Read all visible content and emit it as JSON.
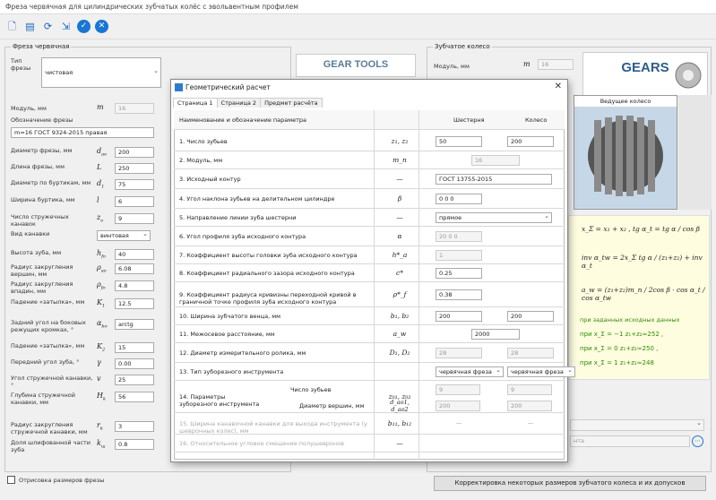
{
  "window": {
    "title": "Фреза червячная для цилиндрических зубчатых колёс с эвольвентным профилем"
  },
  "toolbar": {
    "icons": [
      "new-file-icon",
      "open-icon",
      "refresh-icon",
      "import-icon",
      "ok-icon",
      "cancel-icon"
    ]
  },
  "left": {
    "group_title": "Фреза червячная",
    "type_label": "Тип фрезы",
    "type_value": "чистовая",
    "module_label": "Модуль, мм",
    "module_sym": "m",
    "module_value": "16",
    "designation_label": "Обозначение фрезы",
    "designation_value": "m=16 ГОСТ 9324-2015 правая",
    "rows": [
      {
        "label": "Диаметр фрезы, мм",
        "sym": "d",
        "value": "200"
      },
      {
        "label": "Длина фрезы, мм",
        "sym": "L",
        "value": "250"
      },
      {
        "label": "Диаметр по буртикам, мм",
        "sym": "d",
        "value": "75"
      },
      {
        "label": "Ширина буртика, мм",
        "sym": "l",
        "value": "6"
      },
      {
        "label": "Число стружечных канавок",
        "sym": "z",
        "value": "9"
      },
      {
        "label": "Вид канавки",
        "sym": "",
        "value": "винтовая"
      },
      {
        "label": "Высота зуба, мм",
        "sym": "h",
        "value": "40"
      },
      {
        "label": "Радиус закругления вершин, мм",
        "sym": "ρ",
        "value": "6.08"
      },
      {
        "label": "Радиус закругления впадин, мм",
        "sym": "ρ",
        "value": "4.8"
      },
      {
        "label": "Падение «затылка», мм",
        "sym": "K",
        "value": "12.5"
      },
      {
        "label": "Задний угол на боковых режущих кромках, °",
        "sym": "α",
        "value": "arctg"
      },
      {
        "label": "Падение «затылка», мм",
        "sym": "K",
        "value": "15"
      },
      {
        "label": "Передний угол зуба, °",
        "sym": "γ",
        "value": "0.00"
      },
      {
        "label": "Угол стружечной канавки, °",
        "sym": "v",
        "value": "25"
      },
      {
        "label": "Глубина стружечной канавки, мм",
        "sym": "H",
        "value": "56"
      },
      {
        "label": "Радиус закругления стружечной канавки, мм",
        "sym": "r",
        "value": "3"
      },
      {
        "label": "Доля шлифованной части зуба",
        "sym": "k",
        "value": "0.8"
      }
    ],
    "checkbox_label": "Отрисовка размеров фрезы"
  },
  "middle": {
    "logo": "GEAR TOOLS"
  },
  "right": {
    "group_title": "Зубчатое колесо",
    "module_label": "Модуль, мм",
    "module_sym": "m",
    "module_value": "16",
    "logo": "GEARS",
    "image_label": "Ведущее колесо",
    "formulas": [
      "x_Σ = x₁ + x₂ ,  tg α_t = tg α / cos β",
      "inv α_tw = 2x_Σ tg α / (z₁+z₂) + inv α_t",
      "a_w = (z₁+z₂)m_n / 2cos β · cos α_t / cos α_tw"
    ],
    "note": "при заданных исходных данных",
    "cases": [
      "при  x_Σ = −1  z₁+z₂≈252 ,",
      "при  x_Σ = 0    z₁+z₂≈250 ,",
      "при  x_Σ = 1    z₁+z₂≈248"
    ],
    "bottom_text": "нта",
    "correction_button": "Корректировка некоторых размеров зубчатого колеса и их допусков"
  },
  "dialog": {
    "title": "Геометрический расчет",
    "tabs": [
      "Страница 1",
      "Страница 2",
      "Предмет расчёта"
    ],
    "headers": {
      "param": "Наименование и обозначение параметра",
      "gear1": "Шестерня",
      "gear2": "Колесо"
    },
    "rows": [
      {
        "n": "1. Число зубьев",
        "sym": "z₁, z₂",
        "v1": "50",
        "v2": "200"
      },
      {
        "n": "2. Модуль, мм",
        "sym": "m_n",
        "v1": "16",
        "v2": ""
      },
      {
        "n": "3. Исходный контур",
        "sym": "—",
        "v1": "ГОСТ 13755-2015",
        "v2": ""
      },
      {
        "n": "4. Угол наклона зубьев на делительном цилиндре",
        "sym": "β",
        "v1": "0  0  0",
        "v2": ""
      },
      {
        "n": "5. Направление линии зуба шестерни",
        "sym": "—",
        "v1": "прямое",
        "v2": ""
      },
      {
        "n": "6. Угол профиля зуба исходного контура",
        "sym": "α",
        "v1": "20  0  0",
        "v2": ""
      },
      {
        "n": "7. Коэффициент высоты головки зуба исходного контура",
        "sym": "h*_a",
        "v1": "1",
        "v2": ""
      },
      {
        "n": "8. Коэффициент радиального зазора исходного контура",
        "sym": "c*",
        "v1": "0.25",
        "v2": ""
      },
      {
        "n": "9. Коэффициент радиуса кривизны переходной кривой в граничной точке профиля зуба исходного контура",
        "sym": "ρ*_f",
        "v1": "0.38",
        "v2": ""
      },
      {
        "n": "10. Ширина зубчатого венца, мм",
        "sym": "b₁, b₂",
        "v1": "200",
        "v2": "200"
      },
      {
        "n": "11. Межосевое расстояние, мм",
        "sym": "a_w",
        "v1": "2000",
        "v2": ""
      },
      {
        "n": "12. Диаметр измерительного ролика, мм",
        "sym": "D₁, D₂",
        "v1": "28",
        "v2": "28"
      },
      {
        "n": "13. Тип зуборезного инструмента",
        "sym": "",
        "v1": "червячная фреза",
        "v2": "червячная фреза"
      },
      {
        "n": "14. Параметры зуборезного инструмента",
        "sub1": "Число зубьев",
        "sub2": "Диаметр вершин, мм",
        "sym": "z₀₁, z₀₂",
        "sym2": "d_ao1, d_ao2",
        "v1": "9",
        "v2": "9",
        "v3": "200",
        "v4": "200"
      },
      {
        "n": "15. Ширина канавочной канавки для выхода инструмента (у шевронных колес), мм",
        "sym": "b₁₁, b₁₂",
        "v1": "—",
        "v2": "—"
      },
      {
        "n": "16. Относительное угловое смещение полушевронов",
        "sym": "—",
        "v1": "",
        "v2": ""
      }
    ]
  }
}
